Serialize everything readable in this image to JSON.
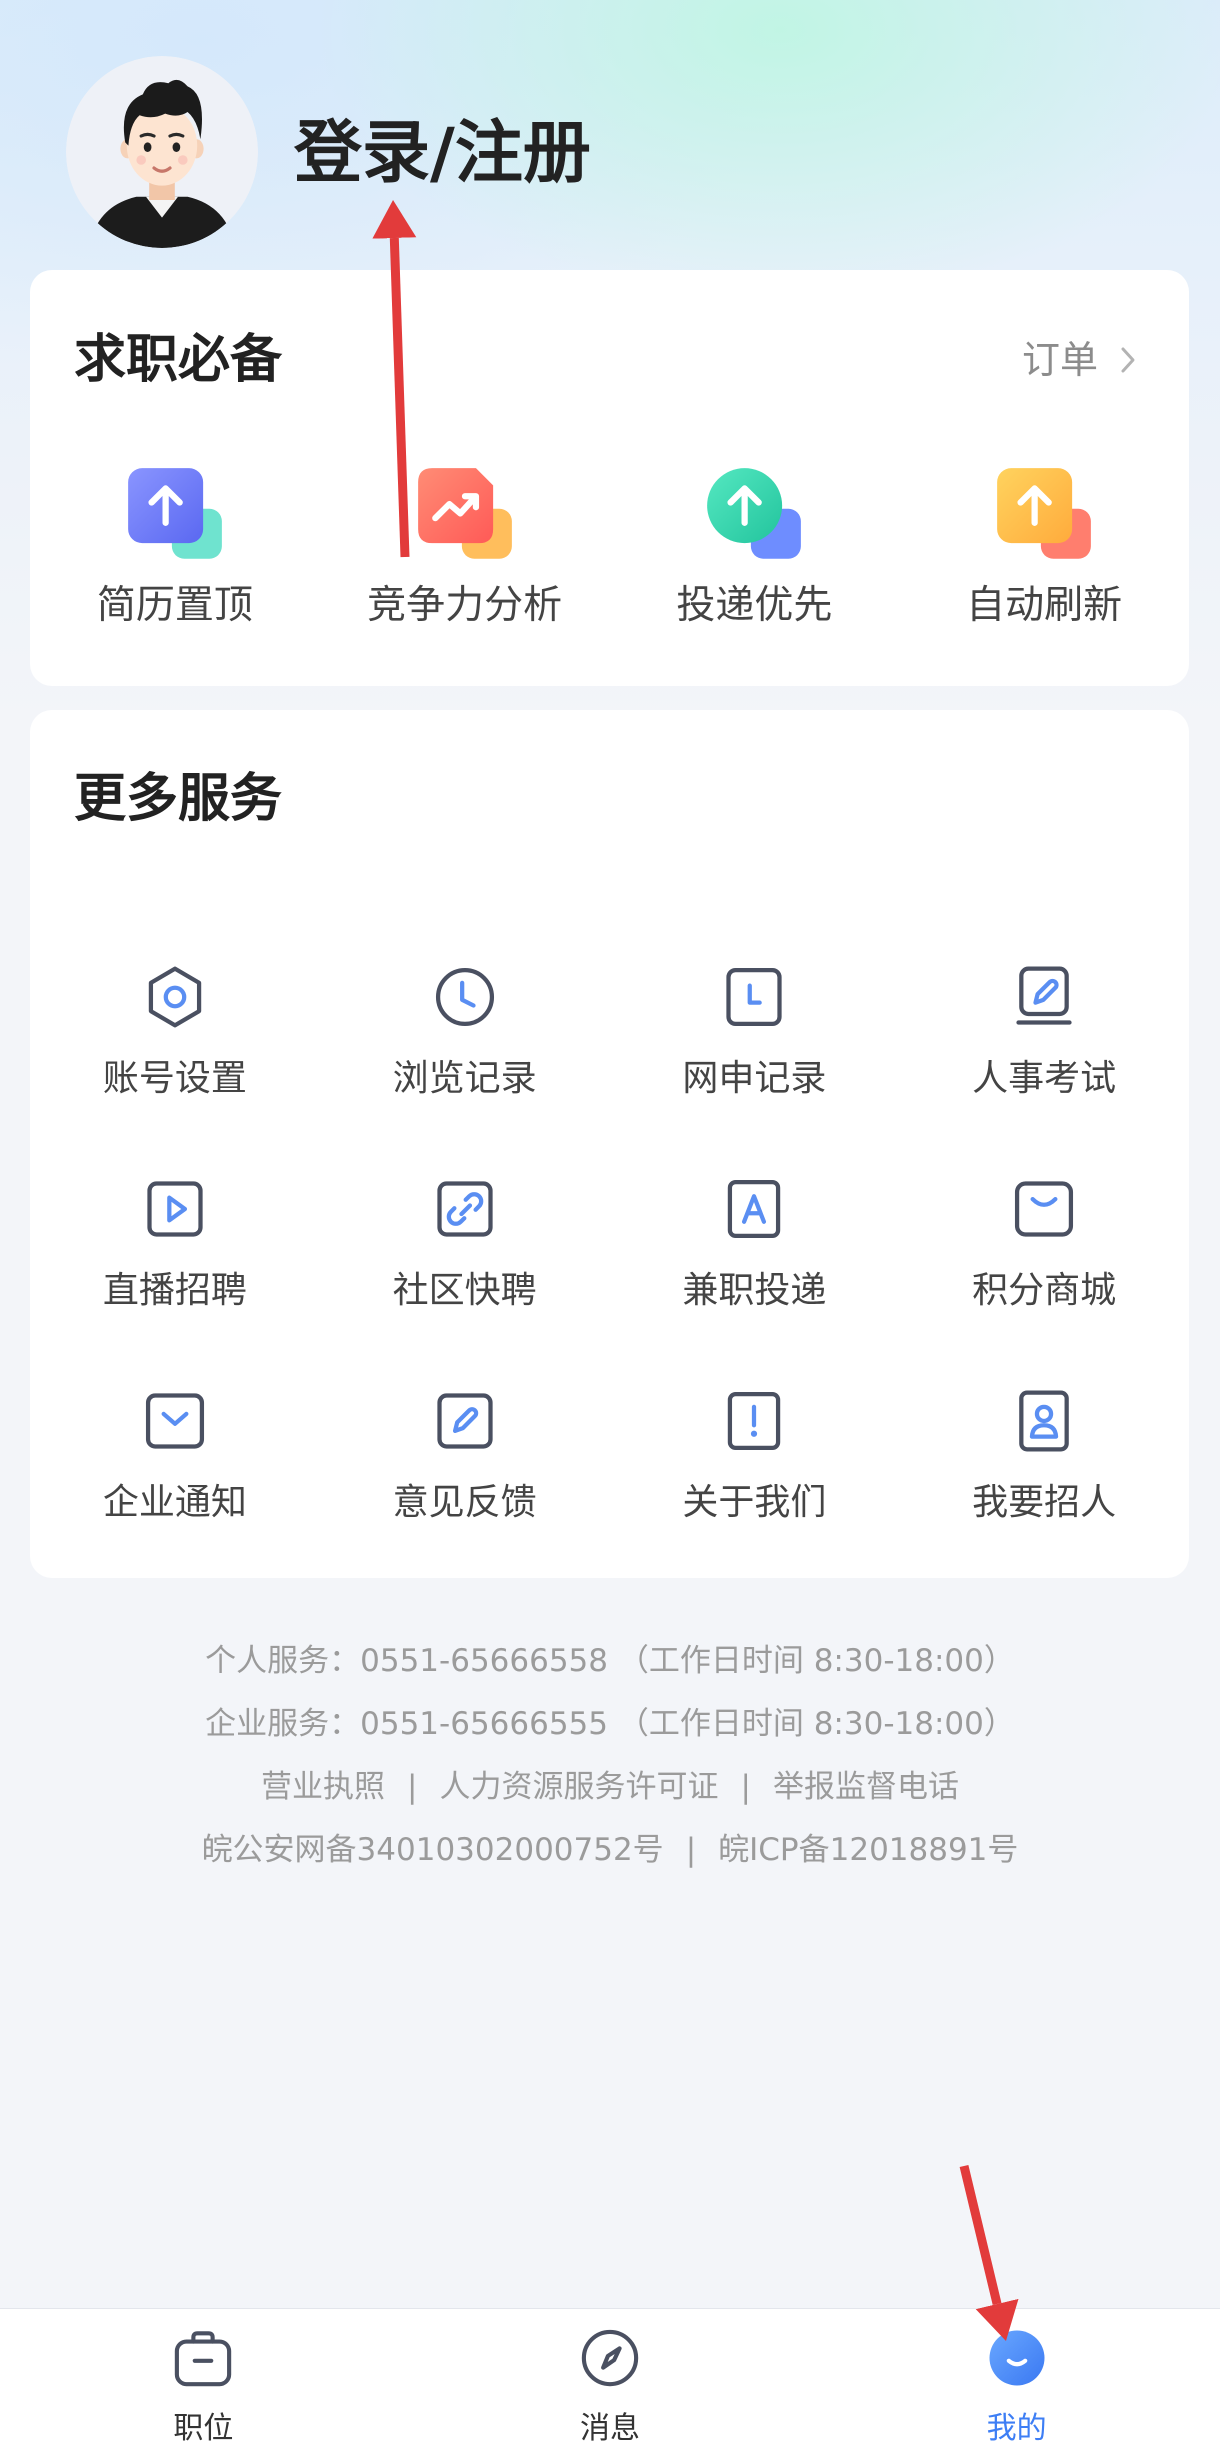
{
  "header": {
    "login_label": "登录/注册"
  },
  "essentials": {
    "title": "求职必备",
    "orders_link": "订单",
    "items": [
      {
        "label": "简历置顶",
        "icon": "resume-top-icon"
      },
      {
        "label": "竞争力分析",
        "icon": "competitiveness-chart-icon"
      },
      {
        "label": "投递优先",
        "icon": "delivery-priority-icon"
      },
      {
        "label": "自动刷新",
        "icon": "auto-refresh-icon"
      }
    ]
  },
  "services": {
    "title": "更多服务",
    "items": [
      {
        "label": "账号设置",
        "icon": "settings-hexagon-icon"
      },
      {
        "label": "浏览记录",
        "icon": "clock-icon"
      },
      {
        "label": "网申记录",
        "icon": "application-record-icon"
      },
      {
        "label": "人事考试",
        "icon": "exam-icon"
      },
      {
        "label": "直播招聘",
        "icon": "live-play-icon"
      },
      {
        "label": "社区快聘",
        "icon": "link-icon"
      },
      {
        "label": "兼职投递",
        "icon": "letter-a-icon"
      },
      {
        "label": "积分商城",
        "icon": "mall-icon"
      },
      {
        "label": "企业通知",
        "icon": "mail-notice-icon"
      },
      {
        "label": "意见反馈",
        "icon": "feedback-pencil-icon"
      },
      {
        "label": "关于我们",
        "icon": "info-icon"
      },
      {
        "label": "我要招人",
        "icon": "recruit-person-icon"
      }
    ]
  },
  "footer": {
    "personal_service": "个人服务：0551-65666558 （工作日时间 8:30-18:00）",
    "enterprise_service": "企业服务：0551-65666555 （工作日时间 8:30-18:00）",
    "separator": "|",
    "links": [
      "营业执照",
      "人力资源服务许可证",
      "举报监督电话"
    ],
    "records": [
      "皖公安网备34010302000752号",
      "皖ICP备12018891号"
    ]
  },
  "tabbar": {
    "items": [
      {
        "label": "职位",
        "icon": "briefcase-icon",
        "active": false
      },
      {
        "label": "消息",
        "icon": "compass-icon",
        "active": false
      },
      {
        "label": "我的",
        "icon": "profile-icon",
        "active": true
      }
    ]
  },
  "colors": {
    "accent": "#3d7ef5",
    "text_primary": "#222222",
    "text_secondary": "#444444",
    "text_muted": "#9b9b9b",
    "icon_stroke": "#4a5061",
    "icon_accent": "#5a8ef2",
    "annotation_arrow": "#e23b3b"
  }
}
